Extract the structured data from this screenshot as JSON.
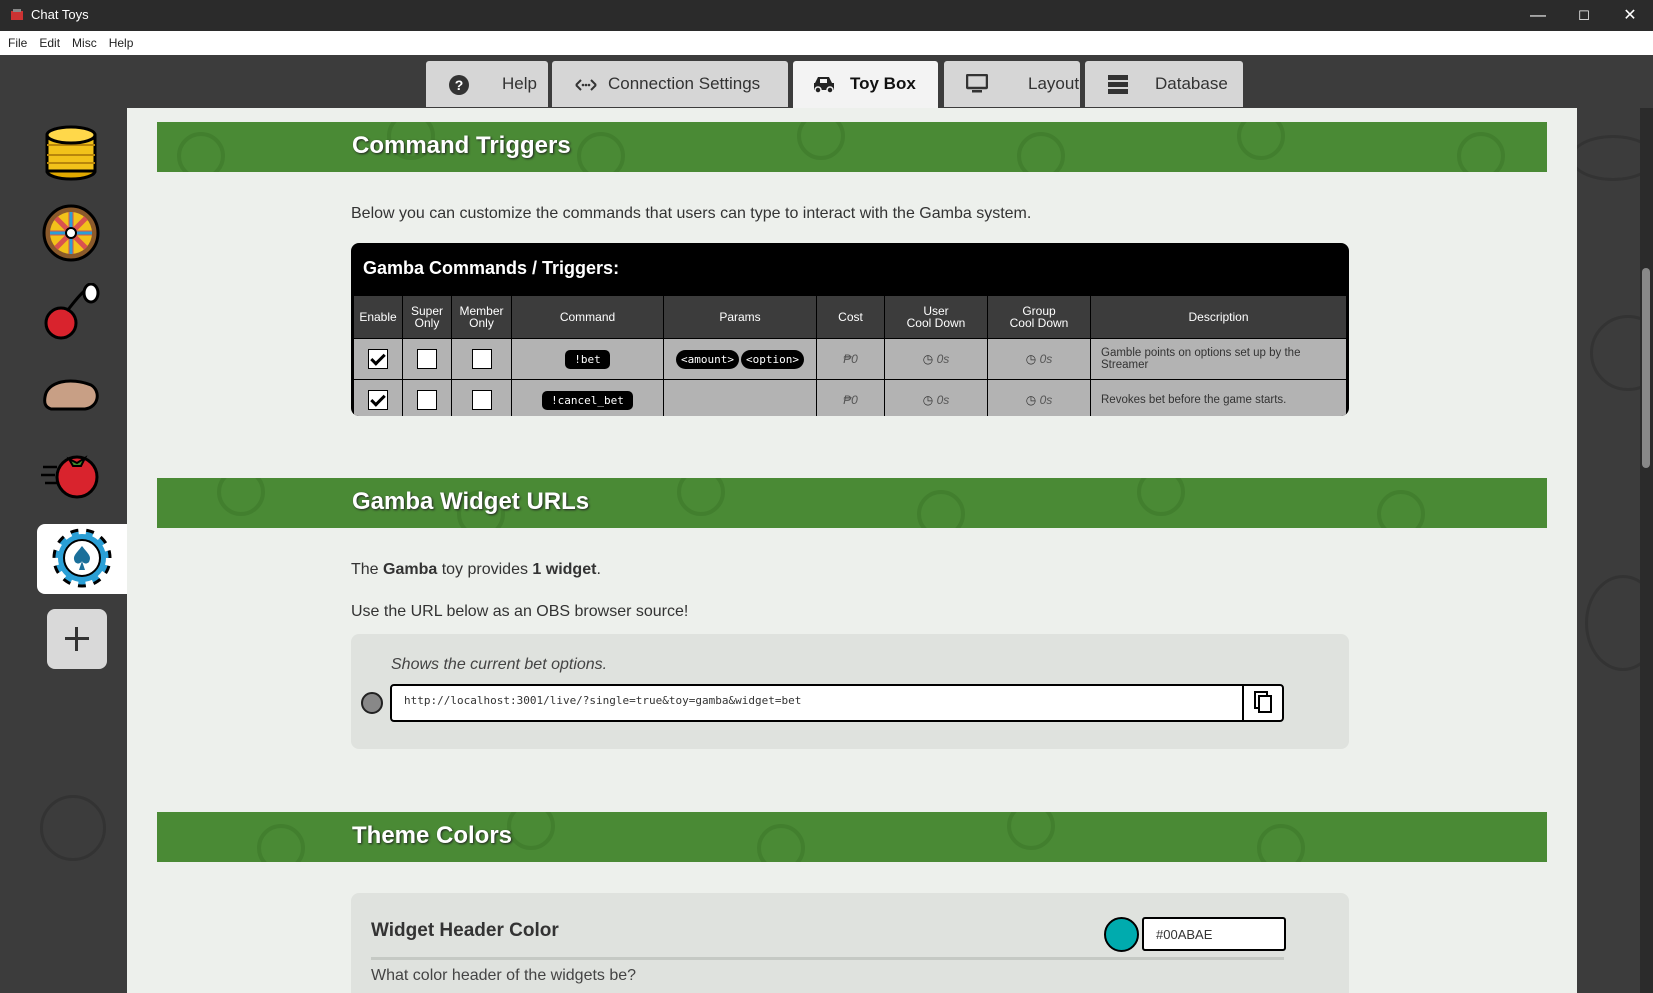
{
  "window": {
    "title": "Chat Toys",
    "controls": {
      "minimize": "—",
      "maximize": "☐",
      "close": "✕"
    }
  },
  "menu": [
    "File",
    "Edit",
    "Misc",
    "Help"
  ],
  "tabs": [
    {
      "label": "Help",
      "icon": "question-icon"
    },
    {
      "label": "Connection Settings",
      "icon": "connection-icon"
    },
    {
      "label": "Toy Box",
      "icon": "car-icon",
      "active": true
    },
    {
      "label": "Layout",
      "icon": "monitor-icon"
    },
    {
      "label": "Database",
      "icon": "database-icon"
    }
  ],
  "toys": [
    "coins",
    "wheel",
    "cherry",
    "hand",
    "tomato",
    "poker-chip"
  ],
  "sections": {
    "commands": {
      "title": "Command Triggers",
      "intro": "Below you can customize the commands that users can type to interact with the Gamba system.",
      "table_title": "Gamba Commands / Triggers:",
      "headers": {
        "enable": "Enable",
        "super_1": "Super",
        "super_2": "Only",
        "member_1": "Member",
        "member_2": "Only",
        "command": "Command",
        "params": "Params",
        "cost": "Cost",
        "ucd_1": "User",
        "ucd_2": "Cool Down",
        "gcd_1": "Group",
        "gcd_2": "Cool Down",
        "description": "Description"
      },
      "rows": [
        {
          "enabled": true,
          "super_only": false,
          "member_only": false,
          "command": "!bet",
          "param_1": "<amount>",
          "param_2": "<option>",
          "cost": "₱0",
          "user_cd": "0s",
          "group_cd": "0s",
          "description": "Gamble points on options set up by the Streamer"
        },
        {
          "enabled": true,
          "super_only": false,
          "member_only": false,
          "command": "!cancel_bet",
          "cost": "₱0",
          "user_cd": "0s",
          "group_cd": "0s",
          "description": "Revokes bet before the game starts."
        }
      ]
    },
    "widgets": {
      "title": "Gamba Widget URLs",
      "line1_pre": "The ",
      "line1_toy": "Gamba",
      "line1_mid": " toy provides ",
      "line1_count": "1 widget",
      "line1_end": ".",
      "line2": "Use the URL below as an OBS browser source!",
      "widget_note": "Shows the current bet options.",
      "widget_url": "http://localhost:3001/live/?single=true&toy=gamba&widget=bet"
    },
    "theme": {
      "title": "Theme Colors",
      "header_color_label": "Widget Header Color",
      "header_color_value": "#00ABAE",
      "header_color_question": "What color header of the widgets be?"
    }
  },
  "colors": {
    "accent_green": "#4a8a35",
    "widget_header": "#00ABAE"
  }
}
